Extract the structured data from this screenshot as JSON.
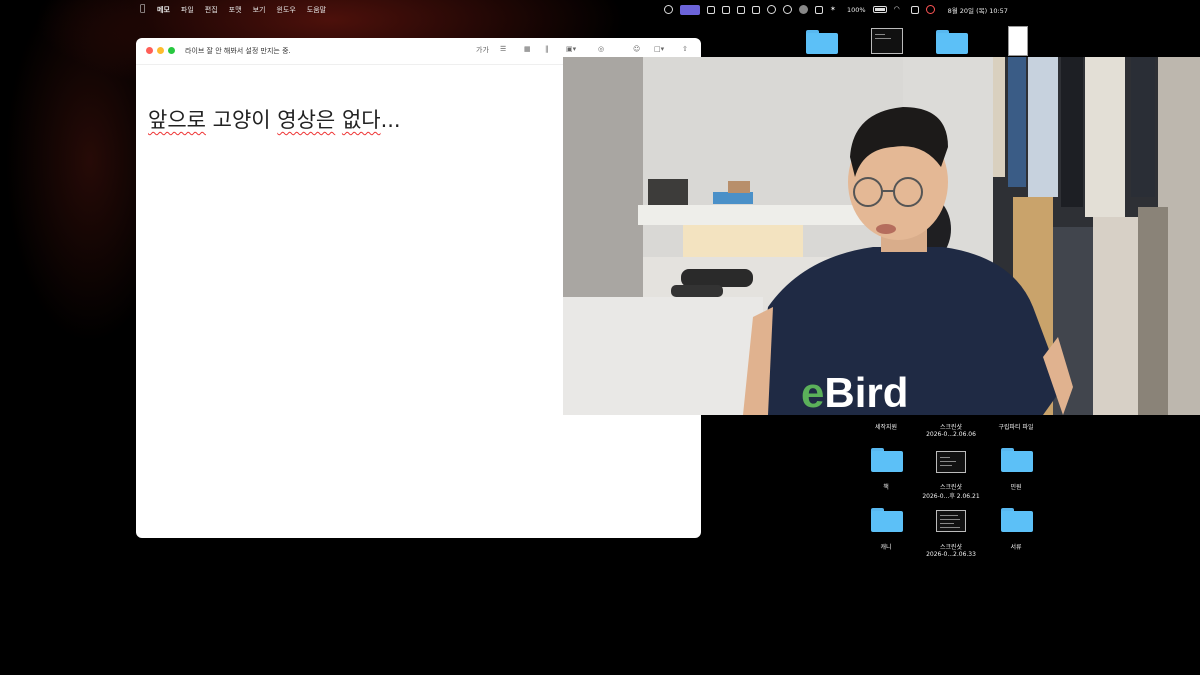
{
  "menubar": {
    "menus": [
      "메모",
      "파일",
      "편집",
      "포맷",
      "보기",
      "윈도우",
      "도움말"
    ],
    "battery": "100%",
    "datetime": "8월 20일 (목) 10:57"
  },
  "note": {
    "title": "라이브 잘 안 해봐서 설정 만지는 중.",
    "toolbar": {
      "format": "가가"
    },
    "body_parts": [
      "앞으로",
      " 고양이 ",
      "영상은",
      " ",
      "없다",
      "..."
    ]
  },
  "webcam": {
    "shirt_text": "eBird",
    "colors": {
      "shirt": "#1f2a44",
      "shirt_e": "#5bb05a"
    }
  },
  "desktop": {
    "labels_top": [
      "세작지원",
      "스크린샷",
      "2026-0...2.06.06",
      "구립파티 파일"
    ],
    "labels_mid": [
      "책",
      "스크린샷",
      "2026-0...후 2.06.21",
      "민원"
    ],
    "labels_bot": [
      "캐니",
      "스크린샷",
      "2026-0...2.06.33",
      "서류"
    ]
  },
  "colors": {
    "folder": "#5cc0f7",
    "accent": "#6b63d9"
  }
}
